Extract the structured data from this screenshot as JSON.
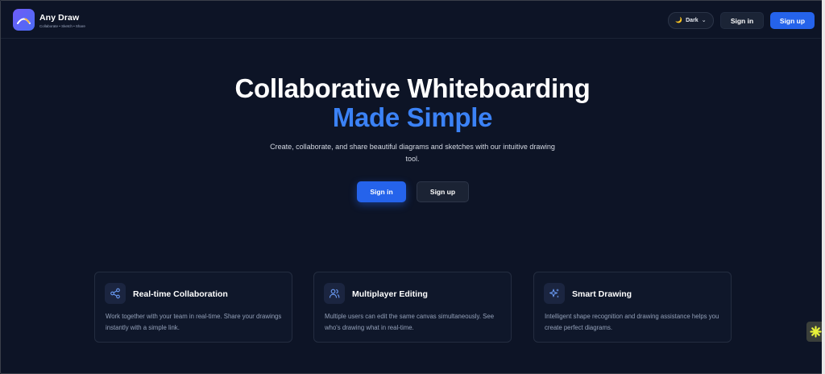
{
  "header": {
    "brand_name": "Any Draw",
    "brand_tagline": "Collaborate • Sketch • Share",
    "theme_label": "Dark",
    "signin_label": "Sign in",
    "signup_label": "Sign up"
  },
  "hero": {
    "title": "Collaborative Whiteboarding",
    "title_accent": "Made Simple",
    "subtitle": "Create, collaborate, and share beautiful diagrams and sketches with our intuitive drawing tool.",
    "signin_label": "Sign in",
    "signup_label": "Sign up"
  },
  "features": [
    {
      "icon": "share-icon",
      "title": "Real-time Collaboration",
      "description": "Work together with your team in real-time. Share your drawings instantly with a simple link."
    },
    {
      "icon": "users-icon",
      "title": "Multiplayer Editing",
      "description": "Multiple users can edit the same canvas simultaneously. See who's drawing what in real-time."
    },
    {
      "icon": "sparkles-icon",
      "title": "Smart Drawing",
      "description": "Intelligent shape recognition and drawing assistance helps you create perfect diagrams."
    }
  ],
  "colors": {
    "background": "#0d1426",
    "accent": "#2563eb",
    "accent_text": "#3b82f6",
    "card_background": "#0f172a",
    "widget_icon": "#e8f23a"
  }
}
